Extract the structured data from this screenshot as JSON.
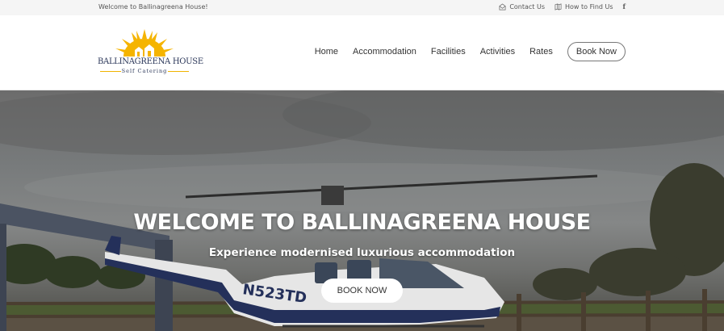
{
  "topbar": {
    "welcome": "Welcome to Ballinagreena House!",
    "contact": "Contact Us",
    "directions": "How to Find Us",
    "social": "f"
  },
  "logo": {
    "name": "BALLINAGREENA HOUSE",
    "tagline": "Self Catering"
  },
  "nav": {
    "items": [
      "Home",
      "Accommodation",
      "Facilities",
      "Activities",
      "Rates"
    ],
    "book": "Book Now"
  },
  "hero": {
    "title": "WELCOME TO BALLINAGREENA HOUSE",
    "subtitle": "Experience modernised luxurious accommodation",
    "cta": "BOOK NOW",
    "tail_number": "N523TD"
  },
  "colors": {
    "sun": "#f5b400",
    "brand_text": "#2a3658",
    "helicopter_body": "#e8e8e8",
    "helicopter_stripe": "#24305a"
  }
}
